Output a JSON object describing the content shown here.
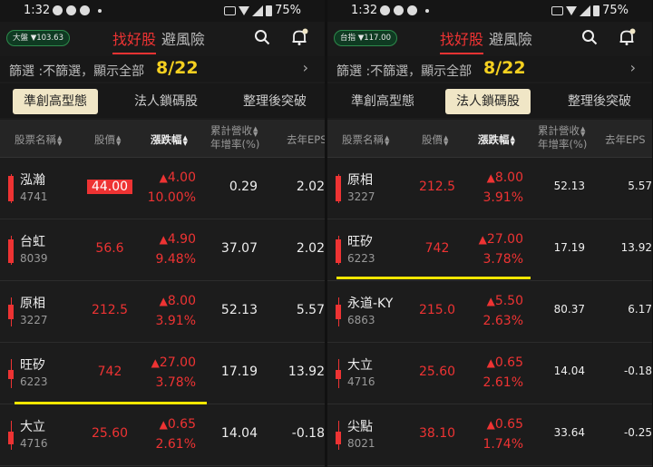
{
  "status_time": "1:32",
  "status_battery": "75%",
  "colors": {
    "up": "#e53935",
    "accent_yellow": "#f5d020",
    "index_green": "#2d8a4b",
    "active_tab_bg": "#f0e6c6"
  },
  "nav_tabs": [
    "找好股",
    "避風險"
  ],
  "filter_label": "篩選 :不篩選，顯示全部",
  "table_headers": {
    "name": "股票名稱",
    "price": "股價",
    "change": "漲跌幅",
    "rev_line1": "累計營收",
    "rev_line2": "年增率(%)",
    "eps": "去年EPS"
  },
  "subtabs": [
    "準創高型態",
    "法人鎖碼股",
    "整理後突破"
  ],
  "panels": [
    {
      "index_badge": "大盤 ▼103.63",
      "filter_count": "8/22",
      "active_subtab": 0,
      "rows": [
        {
          "name": "泓瀚",
          "code": "4741",
          "price": "44.00",
          "change": "4.00",
          "pct": "10.00%",
          "rev": "0.29",
          "eps": "2.02"
        },
        {
          "name": "台虹",
          "code": "8039",
          "price": "56.6",
          "change": "4.90",
          "pct": "9.48%",
          "rev": "37.07",
          "eps": "2.02"
        },
        {
          "name": "原相",
          "code": "3227",
          "price": "212.5",
          "change": "8.00",
          "pct": "3.91%",
          "rev": "52.13",
          "eps": "5.57"
        },
        {
          "name": "旺矽",
          "code": "6223",
          "price": "742",
          "change": "27.00",
          "pct": "3.78%",
          "rev": "17.19",
          "eps": "13.92"
        },
        {
          "name": "大立",
          "code": "4716",
          "price": "25.60",
          "change": "0.65",
          "pct": "2.61%",
          "rev": "14.04",
          "eps": "-0.18"
        }
      ]
    },
    {
      "index_badge": "台指 ▼117.00",
      "filter_count": "8/22",
      "active_subtab": 1,
      "rows": [
        {
          "name": "原相",
          "code": "3227",
          "price": "212.5",
          "change": "8.00",
          "pct": "3.91%",
          "rev": "52.13",
          "eps": "5.57"
        },
        {
          "name": "旺矽",
          "code": "6223",
          "price": "742",
          "change": "27.00",
          "pct": "3.78%",
          "rev": "17.19",
          "eps": "13.92"
        },
        {
          "name": "永道-KY",
          "code": "6863",
          "price": "215.0",
          "change": "5.50",
          "pct": "2.63%",
          "rev": "80.37",
          "eps": "6.17"
        },
        {
          "name": "大立",
          "code": "4716",
          "price": "25.60",
          "change": "0.65",
          "pct": "2.61%",
          "rev": "14.04",
          "eps": "-0.18"
        },
        {
          "name": "尖點",
          "code": "8021",
          "price": "38.10",
          "change": "0.65",
          "pct": "1.74%",
          "rev": "33.64",
          "eps": "-0.25"
        }
      ]
    }
  ]
}
